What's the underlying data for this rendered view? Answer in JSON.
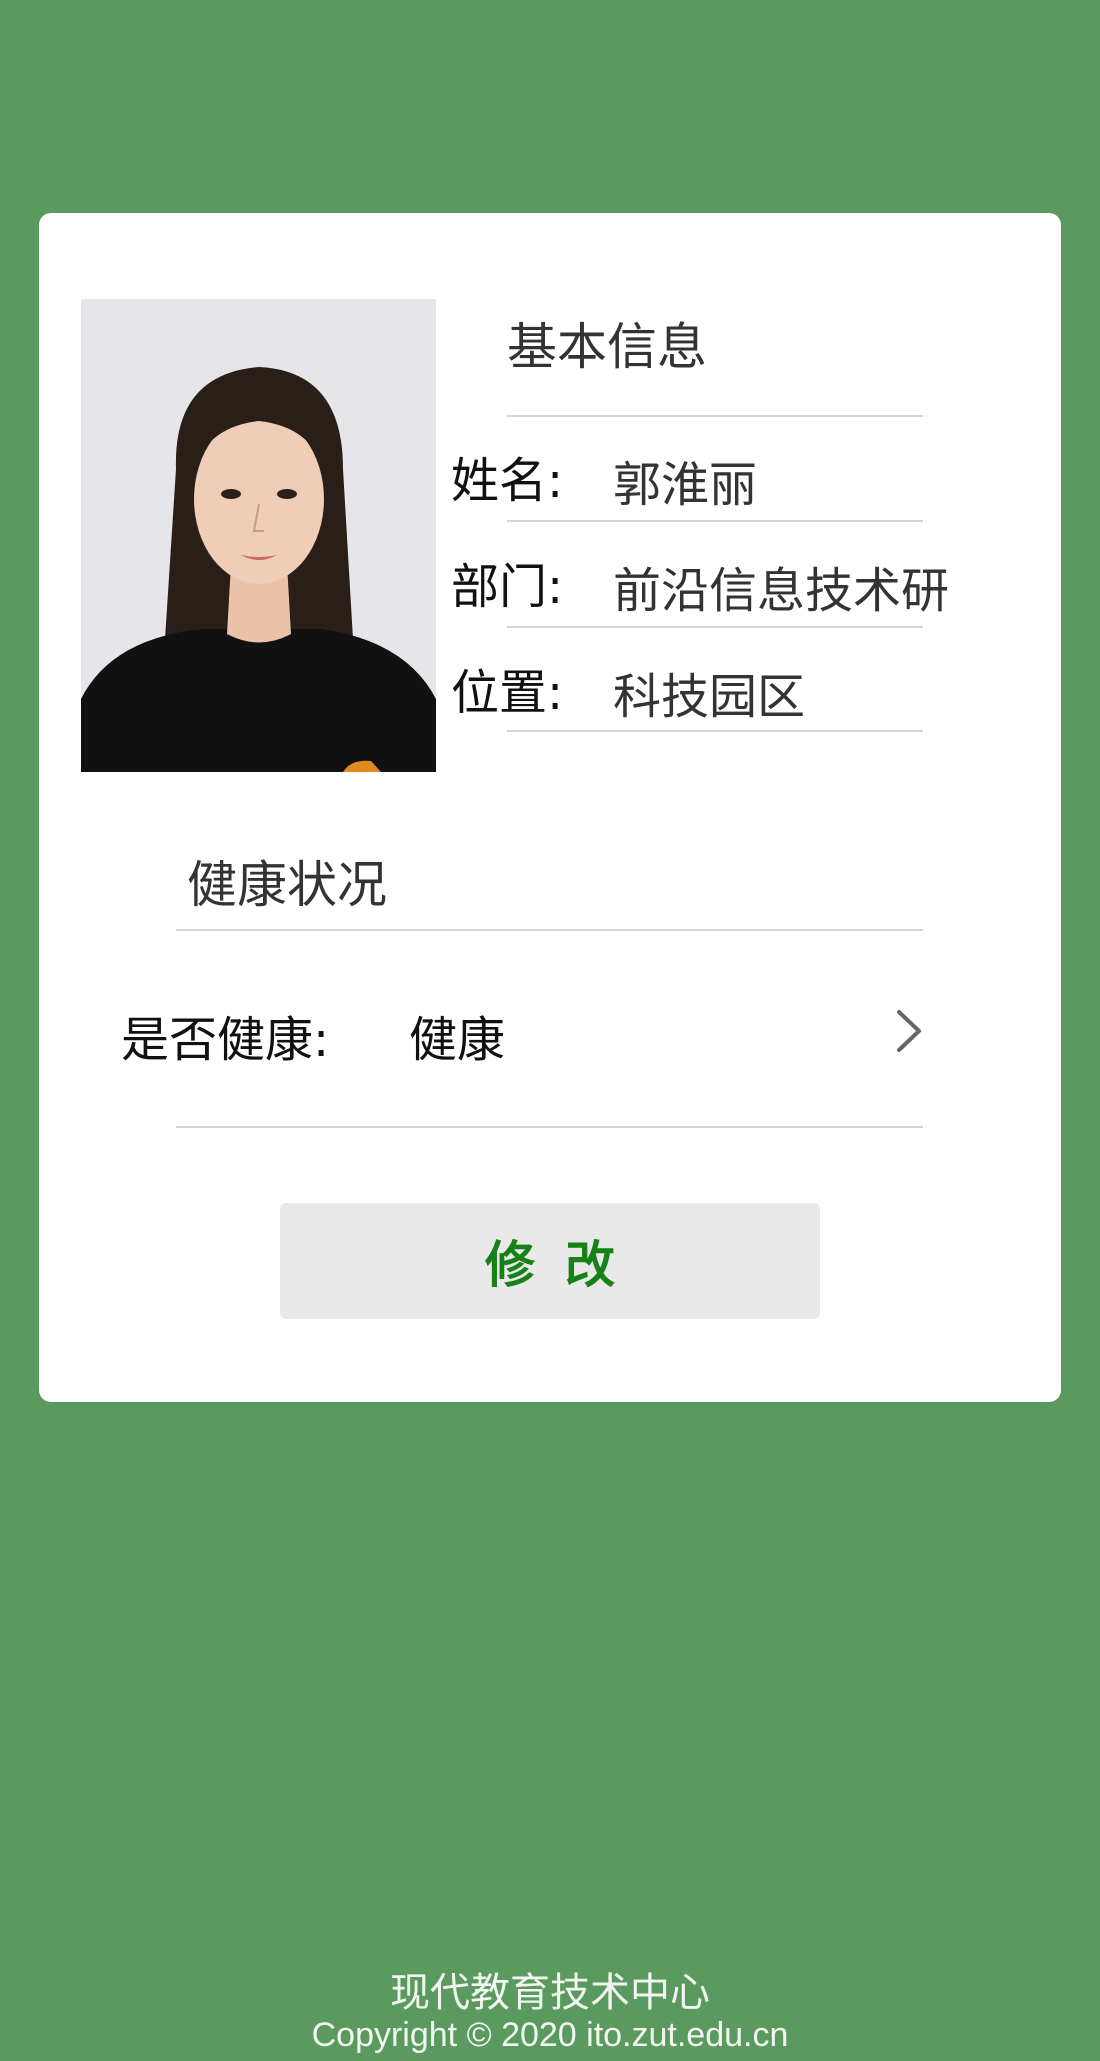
{
  "basic_info": {
    "title": "基本信息",
    "fields": [
      {
        "label": "姓名:",
        "value": "郭淮丽"
      },
      {
        "label": "部门:",
        "value": "前沿信息技术研"
      },
      {
        "label": "位置:",
        "value": "科技园区"
      }
    ]
  },
  "health": {
    "title": "健康状况",
    "label": "是否健康:",
    "value": "健康"
  },
  "actions": {
    "modify_label": "修改"
  },
  "footer": {
    "org": "现代教育技术中心",
    "copyright": "Copyright © 2020 ito.zut.edu.cn"
  },
  "colors": {
    "page_background": "#5a9a5e",
    "card_background": "#ffffff",
    "button_background": "#e9e9e9",
    "button_text": "#178017"
  },
  "icons": {
    "row_arrow": "chevron-right-icon"
  }
}
